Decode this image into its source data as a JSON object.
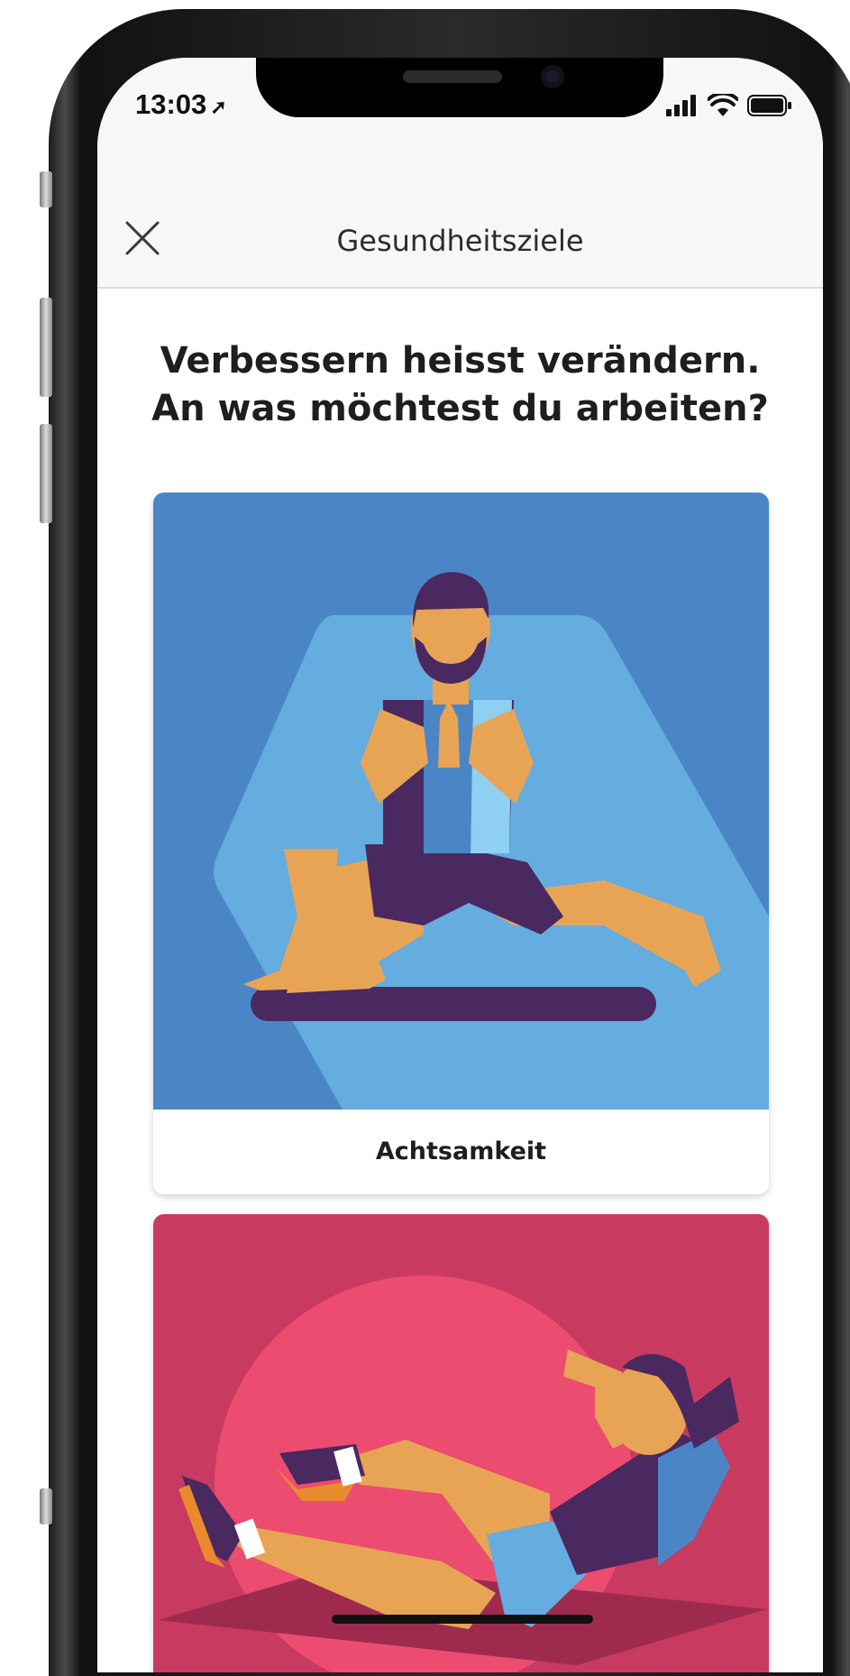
{
  "status_bar": {
    "time": "13:03",
    "location_arrow": "➚"
  },
  "nav": {
    "title": "Gesundheitsziele",
    "close_icon": "close-icon"
  },
  "main": {
    "headline": "Verbessern heisst verändern. An was möchtest du arbeiten?",
    "cards": [
      {
        "label": "Achtsamkeit",
        "background": "#4A86C6",
        "shape_color": "#65ACDF",
        "illustration": "meditating-man-lunge"
      },
      {
        "label": "",
        "background": "#C83A60",
        "shape_color": "#EC4C70",
        "illustration": "woman-bicycle-crunch"
      }
    ]
  },
  "colors": {
    "figure_purple": "#4A2860",
    "skin": "#E8A455",
    "shoe_orange": "#E98A2E"
  }
}
